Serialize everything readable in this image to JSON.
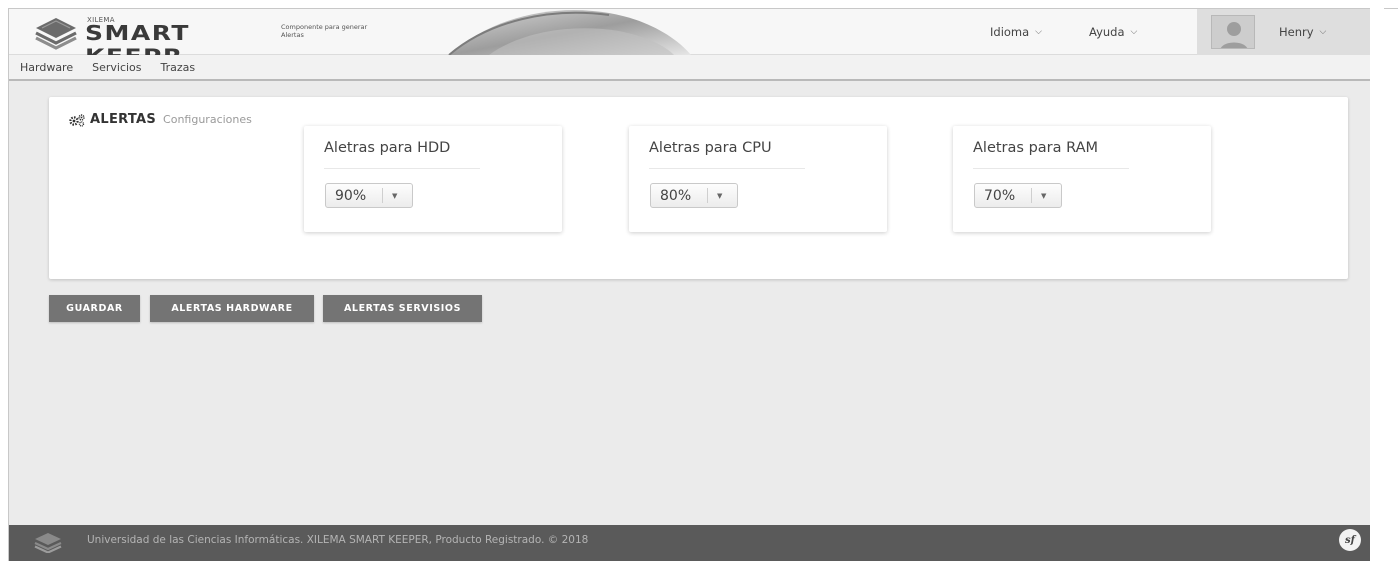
{
  "header": {
    "brand_small": "XILEMA",
    "brand_name": "SMART KEEPR",
    "brand_tagline": "Componente para generar Alertas",
    "menu_language": "Idioma",
    "menu_help": "Ayuda",
    "user_name": "Henry"
  },
  "nav": {
    "items": [
      {
        "label": "Hardware"
      },
      {
        "label": "Servicios"
      },
      {
        "label": "Trazas"
      }
    ]
  },
  "panel": {
    "title": "ALERTAS",
    "subtitle": "Configuraciones",
    "cards": [
      {
        "title": "Aletras para HDD",
        "value": "90%"
      },
      {
        "title": "Aletras para CPU",
        "value": "80%"
      },
      {
        "title": "Aletras para RAM",
        "value": "70%"
      }
    ]
  },
  "actions": {
    "save": "GUARDAR",
    "hardware_alerts": "ALERTAS HARDWARE",
    "service_alerts": "ALERTAS SERVISIOS"
  },
  "footer": {
    "text": "Universidad de las Ciencias Informáticas. XILEMA SMART KEEPER, Producto Registrado. © 2018",
    "badge": "sf"
  },
  "icons": {
    "logo": "xilema-logo-icon",
    "dropdown": "chevron-down-icon",
    "settings": "gears-icon",
    "avatar": "user-avatar-icon",
    "framework": "symfony-icon"
  },
  "colors": {
    "button_bg": "#747474",
    "footer_bg": "#5a5a5a",
    "page_bg": "#ebebeb"
  }
}
